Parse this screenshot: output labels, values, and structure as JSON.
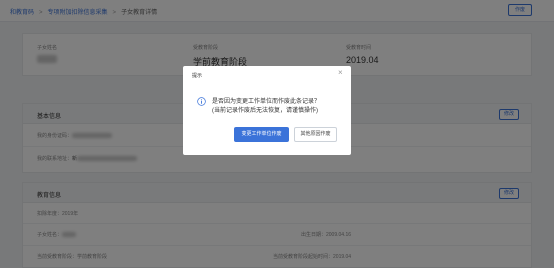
{
  "breadcrumb": [
    "和教育码",
    "专项附加扣除信息采集",
    "子女教育详情"
  ],
  "header": {
    "void_button": "作废"
  },
  "summary": {
    "child_name_label": "子女姓名",
    "stage_label": "受教育阶段",
    "stage_value": "学前教育阶段",
    "start_label": "受教育时间",
    "start_value": "2019.04"
  },
  "basic_section": {
    "title": "基本信息",
    "edit_button": "修改",
    "rows": [
      {
        "label": "我的身份证码："
      },
      {
        "label": "我的联系地址：",
        "value": "新"
      }
    ]
  },
  "edu_section": {
    "title": "教育信息",
    "edit_button": "修改",
    "deduction_year": "扣除年度：2019年",
    "child_name_label": "子女姓名：",
    "birth_date": "出生日期：2009.04.16",
    "current_stage": "当前受教育阶段：学前教育阶段",
    "stage_start": "当前受教育阶段起始时间：2019.04"
  },
  "dialog": {
    "title": "提示",
    "close": "×",
    "message_line1": "是否因为变更工作单位而作废此条记录？",
    "message_line2": "(当前记录作废后无法恢复，请谨慎操作)",
    "primary_button": "变更工作单位作废",
    "secondary_button": "其他原因作废",
    "icon": "info-icon",
    "accent_color": "#3b73d9"
  }
}
